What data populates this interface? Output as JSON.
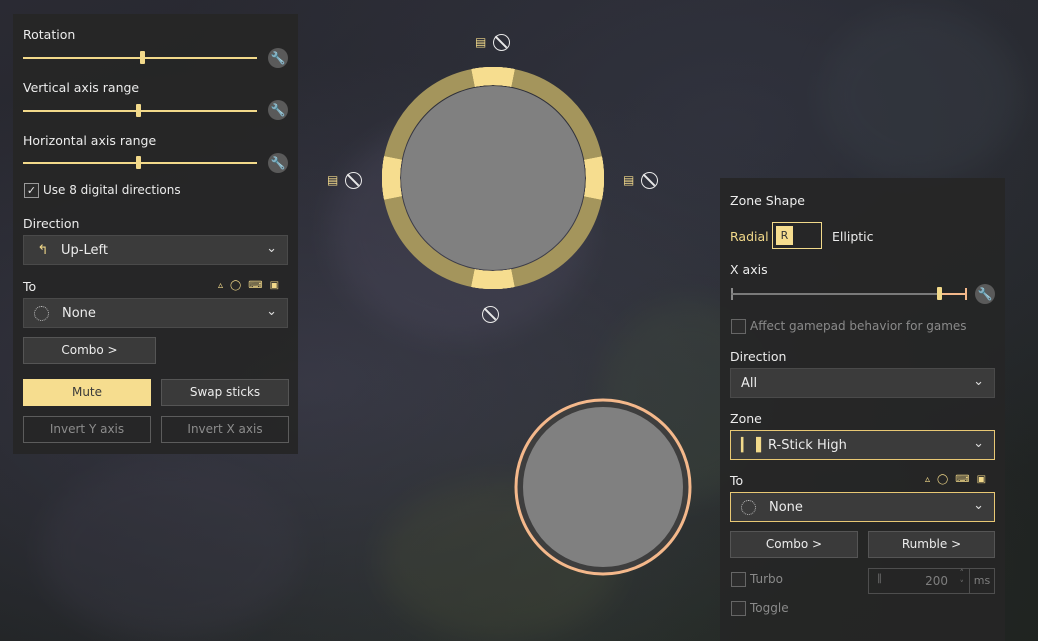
{
  "left": {
    "rotation_label": "Rotation",
    "rotation_value": 0.51,
    "vertical_label": "Vertical axis range",
    "vertical_value": 0.49,
    "horizontal_label": "Horizontal axis range",
    "horizontal_value": 0.49,
    "digital_label": "Use 8 digital directions",
    "digital_checked": true,
    "direction_label": "Direction",
    "direction_value": "Up-Left",
    "to_label": "To",
    "to_value": "None",
    "combo_label": "Combo >",
    "mute_label": "Mute",
    "swap_label": "Swap sticks",
    "invert_y_label": "Invert Y axis",
    "invert_x_label": "Invert X axis"
  },
  "right": {
    "zone_shape_label": "Zone Shape",
    "radial_label": "Radial",
    "shape_key": "R",
    "elliptic_label": "Elliptic",
    "x_axis_label": "X axis",
    "x_axis_value": 0.88,
    "affect_label": "Affect gamepad behavior for games",
    "direction_label": "Direction",
    "direction_value": "All",
    "zone_label": "Zone",
    "zone_value": "R-Stick High",
    "to_label": "To",
    "to_value": "None",
    "combo_label": "Combo >",
    "rumble_label": "Rumble >",
    "turbo_label": "Turbo",
    "toggle_label": "Toggle",
    "turbo_ms_value": "200",
    "ms_label": "ms"
  },
  "colors": {
    "accent": "#f6dd8f",
    "ring_dark": "#a4955c",
    "stick_fill": "#808080",
    "rstick_ring": "#f4b88b"
  },
  "icons": {
    "wrench": "wrench-icon",
    "chevron": "chevron-down-icon",
    "forbidden": "forbidden-icon",
    "script": "script-icon"
  }
}
